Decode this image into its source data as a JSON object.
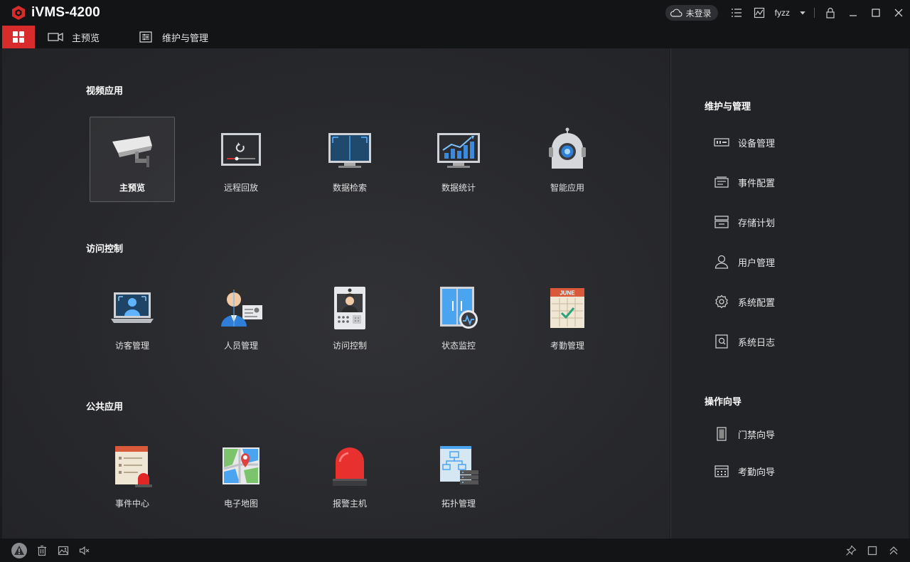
{
  "app": {
    "title": "iVMS-4200"
  },
  "header": {
    "cloud_label": "未登录",
    "user": "fyzz"
  },
  "tabs": [
    {
      "label": "主预览",
      "icon": "camera-icon"
    },
    {
      "label": "维护与管理",
      "icon": "maintenance-icon"
    }
  ],
  "sections": [
    {
      "title": "视频应用",
      "items": [
        "主预览",
        "远程回放",
        "数据检索",
        "数据统计",
        "智能应用"
      ]
    },
    {
      "title": "访问控制",
      "items": [
        "访客管理",
        "人员管理",
        "访问控制",
        "状态监控",
        "考勤管理"
      ]
    },
    {
      "title": "公共应用",
      "items": [
        "事件中心",
        "电子地图",
        "报警主机",
        "拓扑管理"
      ]
    }
  ],
  "calendar_month": "JUNE",
  "right_panel": {
    "maintenance_title": "维护与管理",
    "maintenance_items": [
      "设备管理",
      "事件配置",
      "存储计划",
      "用户管理",
      "系统配置",
      "系统日志"
    ],
    "guide_title": "操作向导",
    "guide_items": [
      "门禁向导",
      "考勤向导"
    ]
  },
  "colors": {
    "accent": "#d82b2b",
    "background": "#26272b",
    "titlebar": "#131416"
  }
}
